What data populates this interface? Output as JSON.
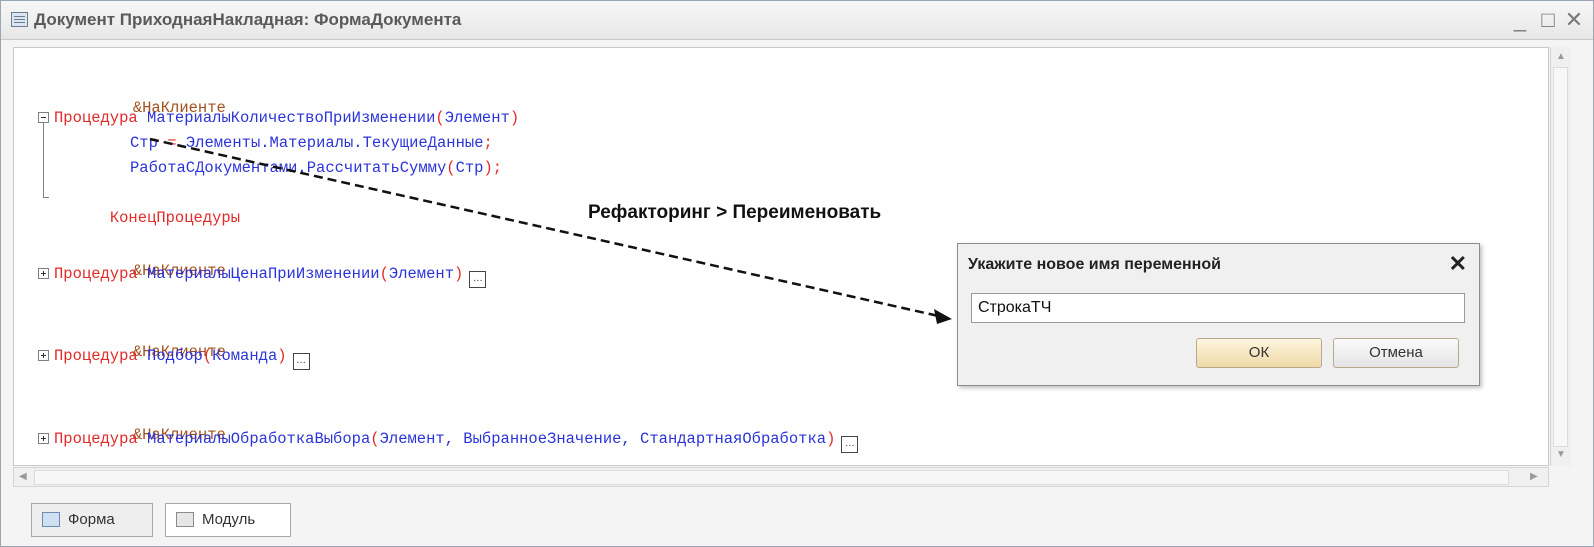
{
  "window": {
    "title": "Документ ПриходнаяНакладная: ФормаДокумента",
    "minimize": "_",
    "maximize": "□",
    "close": "✕"
  },
  "code": {
    "annotation_client": "&НаКлиенте",
    "procedure_kw": "Процедура",
    "end_procedure": "КонецПроцедуры",
    "proc1_name": "МатериалыКоличествоПриИзменении",
    "proc1_params": "Элемент",
    "line_str": "Стр",
    "line_assign": "=",
    "line_rhs": "Элементы.Материалы.ТекущиеДанные",
    "line_semicolon": ";",
    "line_call": "РаботаСДокументами.РассчитатьСумму",
    "line_call_arg": "Стр",
    "proc2_name": "МатериалыЦенаПриИзменении",
    "proc2_params": "Элемент",
    "proc3_name": "Подбор",
    "proc3_params": "Команда",
    "proc4_name": "МатериалыОбработкаВыбора",
    "proc4_params": "Элемент, ВыбранноеЗначение, СтандартнаяОбработка",
    "collapsed_marker": "…"
  },
  "annotation": {
    "text": "Рефакторинг > Переименовать"
  },
  "dialog": {
    "title": "Укажите новое имя переменной",
    "close": "✕",
    "input_value": "СтрокаТЧ",
    "ok": "ОК",
    "cancel": "Отмена"
  },
  "tabs": [
    {
      "label": "Форма",
      "icon": "form-icon"
    },
    {
      "label": "Модуль",
      "icon": "module-icon"
    }
  ]
}
